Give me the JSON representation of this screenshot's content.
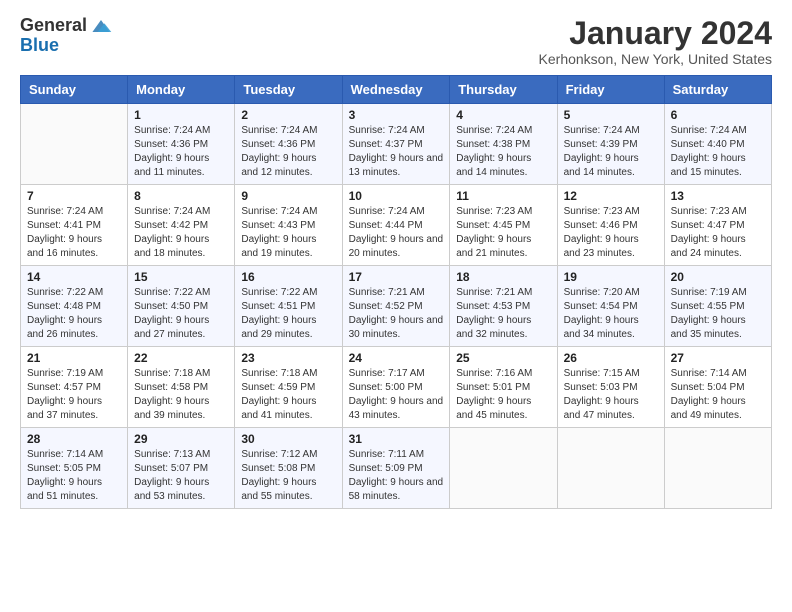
{
  "logo": {
    "general": "General",
    "blue": "Blue"
  },
  "title": "January 2024",
  "subtitle": "Kerhonkson, New York, United States",
  "days_of_week": [
    "Sunday",
    "Monday",
    "Tuesday",
    "Wednesday",
    "Thursday",
    "Friday",
    "Saturday"
  ],
  "weeks": [
    [
      {
        "day": "",
        "sunrise": "",
        "sunset": "",
        "daylight": ""
      },
      {
        "day": "1",
        "sunrise": "Sunrise: 7:24 AM",
        "sunset": "Sunset: 4:36 PM",
        "daylight": "Daylight: 9 hours and 11 minutes."
      },
      {
        "day": "2",
        "sunrise": "Sunrise: 7:24 AM",
        "sunset": "Sunset: 4:36 PM",
        "daylight": "Daylight: 9 hours and 12 minutes."
      },
      {
        "day": "3",
        "sunrise": "Sunrise: 7:24 AM",
        "sunset": "Sunset: 4:37 PM",
        "daylight": "Daylight: 9 hours and 13 minutes."
      },
      {
        "day": "4",
        "sunrise": "Sunrise: 7:24 AM",
        "sunset": "Sunset: 4:38 PM",
        "daylight": "Daylight: 9 hours and 14 minutes."
      },
      {
        "day": "5",
        "sunrise": "Sunrise: 7:24 AM",
        "sunset": "Sunset: 4:39 PM",
        "daylight": "Daylight: 9 hours and 14 minutes."
      },
      {
        "day": "6",
        "sunrise": "Sunrise: 7:24 AM",
        "sunset": "Sunset: 4:40 PM",
        "daylight": "Daylight: 9 hours and 15 minutes."
      }
    ],
    [
      {
        "day": "7",
        "sunrise": "Sunrise: 7:24 AM",
        "sunset": "Sunset: 4:41 PM",
        "daylight": "Daylight: 9 hours and 16 minutes."
      },
      {
        "day": "8",
        "sunrise": "Sunrise: 7:24 AM",
        "sunset": "Sunset: 4:42 PM",
        "daylight": "Daylight: 9 hours and 18 minutes."
      },
      {
        "day": "9",
        "sunrise": "Sunrise: 7:24 AM",
        "sunset": "Sunset: 4:43 PM",
        "daylight": "Daylight: 9 hours and 19 minutes."
      },
      {
        "day": "10",
        "sunrise": "Sunrise: 7:24 AM",
        "sunset": "Sunset: 4:44 PM",
        "daylight": "Daylight: 9 hours and 20 minutes."
      },
      {
        "day": "11",
        "sunrise": "Sunrise: 7:23 AM",
        "sunset": "Sunset: 4:45 PM",
        "daylight": "Daylight: 9 hours and 21 minutes."
      },
      {
        "day": "12",
        "sunrise": "Sunrise: 7:23 AM",
        "sunset": "Sunset: 4:46 PM",
        "daylight": "Daylight: 9 hours and 23 minutes."
      },
      {
        "day": "13",
        "sunrise": "Sunrise: 7:23 AM",
        "sunset": "Sunset: 4:47 PM",
        "daylight": "Daylight: 9 hours and 24 minutes."
      }
    ],
    [
      {
        "day": "14",
        "sunrise": "Sunrise: 7:22 AM",
        "sunset": "Sunset: 4:48 PM",
        "daylight": "Daylight: 9 hours and 26 minutes."
      },
      {
        "day": "15",
        "sunrise": "Sunrise: 7:22 AM",
        "sunset": "Sunset: 4:50 PM",
        "daylight": "Daylight: 9 hours and 27 minutes."
      },
      {
        "day": "16",
        "sunrise": "Sunrise: 7:22 AM",
        "sunset": "Sunset: 4:51 PM",
        "daylight": "Daylight: 9 hours and 29 minutes."
      },
      {
        "day": "17",
        "sunrise": "Sunrise: 7:21 AM",
        "sunset": "Sunset: 4:52 PM",
        "daylight": "Daylight: 9 hours and 30 minutes."
      },
      {
        "day": "18",
        "sunrise": "Sunrise: 7:21 AM",
        "sunset": "Sunset: 4:53 PM",
        "daylight": "Daylight: 9 hours and 32 minutes."
      },
      {
        "day": "19",
        "sunrise": "Sunrise: 7:20 AM",
        "sunset": "Sunset: 4:54 PM",
        "daylight": "Daylight: 9 hours and 34 minutes."
      },
      {
        "day": "20",
        "sunrise": "Sunrise: 7:19 AM",
        "sunset": "Sunset: 4:55 PM",
        "daylight": "Daylight: 9 hours and 35 minutes."
      }
    ],
    [
      {
        "day": "21",
        "sunrise": "Sunrise: 7:19 AM",
        "sunset": "Sunset: 4:57 PM",
        "daylight": "Daylight: 9 hours and 37 minutes."
      },
      {
        "day": "22",
        "sunrise": "Sunrise: 7:18 AM",
        "sunset": "Sunset: 4:58 PM",
        "daylight": "Daylight: 9 hours and 39 minutes."
      },
      {
        "day": "23",
        "sunrise": "Sunrise: 7:18 AM",
        "sunset": "Sunset: 4:59 PM",
        "daylight": "Daylight: 9 hours and 41 minutes."
      },
      {
        "day": "24",
        "sunrise": "Sunrise: 7:17 AM",
        "sunset": "Sunset: 5:00 PM",
        "daylight": "Daylight: 9 hours and 43 minutes."
      },
      {
        "day": "25",
        "sunrise": "Sunrise: 7:16 AM",
        "sunset": "Sunset: 5:01 PM",
        "daylight": "Daylight: 9 hours and 45 minutes."
      },
      {
        "day": "26",
        "sunrise": "Sunrise: 7:15 AM",
        "sunset": "Sunset: 5:03 PM",
        "daylight": "Daylight: 9 hours and 47 minutes."
      },
      {
        "day": "27",
        "sunrise": "Sunrise: 7:14 AM",
        "sunset": "Sunset: 5:04 PM",
        "daylight": "Daylight: 9 hours and 49 minutes."
      }
    ],
    [
      {
        "day": "28",
        "sunrise": "Sunrise: 7:14 AM",
        "sunset": "Sunset: 5:05 PM",
        "daylight": "Daylight: 9 hours and 51 minutes."
      },
      {
        "day": "29",
        "sunrise": "Sunrise: 7:13 AM",
        "sunset": "Sunset: 5:07 PM",
        "daylight": "Daylight: 9 hours and 53 minutes."
      },
      {
        "day": "30",
        "sunrise": "Sunrise: 7:12 AM",
        "sunset": "Sunset: 5:08 PM",
        "daylight": "Daylight: 9 hours and 55 minutes."
      },
      {
        "day": "31",
        "sunrise": "Sunrise: 7:11 AM",
        "sunset": "Sunset: 5:09 PM",
        "daylight": "Daylight: 9 hours and 58 minutes."
      },
      {
        "day": "",
        "sunrise": "",
        "sunset": "",
        "daylight": ""
      },
      {
        "day": "",
        "sunrise": "",
        "sunset": "",
        "daylight": ""
      },
      {
        "day": "",
        "sunrise": "",
        "sunset": "",
        "daylight": ""
      }
    ]
  ]
}
